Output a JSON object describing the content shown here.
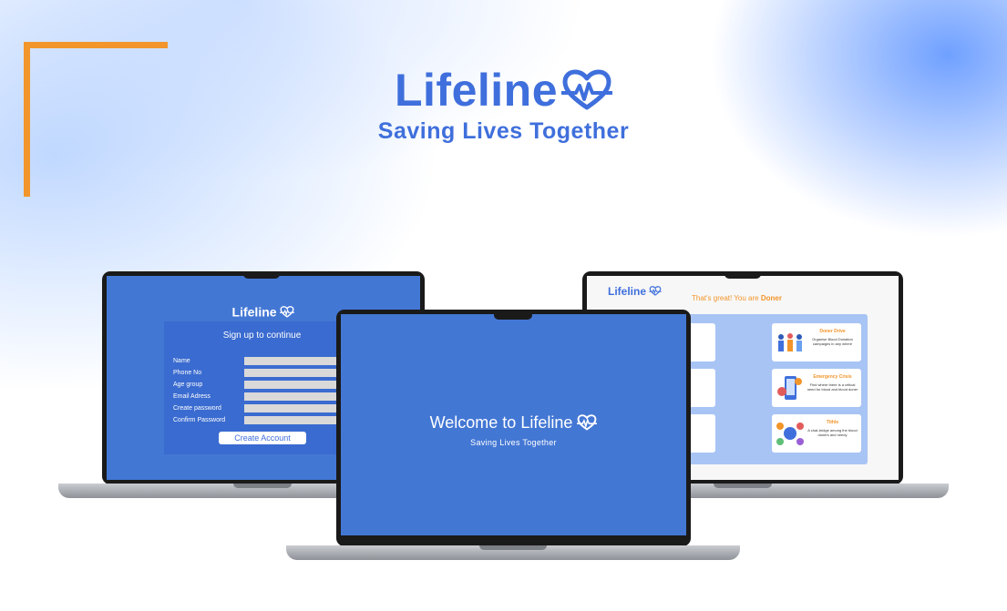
{
  "hero": {
    "brand": "Lifeline",
    "tagline": "Saving Lives Together"
  },
  "signup": {
    "brand": "Lifeline",
    "title": "Sign up to continue",
    "fields": [
      "Name",
      "Phone No",
      "Age group",
      "Email Adress",
      "Create password",
      "Confirm Password"
    ],
    "button": "Create Account"
  },
  "welcome": {
    "title": "Welcome to Lifeline",
    "subtitle": "Saving Lives Together"
  },
  "dashboard": {
    "brand": "Lifeline",
    "heading_prefix": "That's great! You are",
    "role": "Doner",
    "cards": [
      {
        "title": "Doner Drive",
        "desc": "Organise Blood Donation campaigns in any where"
      },
      {
        "title": "Emergency Crisis",
        "desc": "Find where there is a critical need for blood and blood doner"
      },
      {
        "title": "Tithle",
        "desc": "A chat-bridge among the blood doners and needy"
      }
    ]
  },
  "colors": {
    "brand_blue": "#3f6fdc",
    "screen_blue": "#4377d4",
    "accent_orange": "#f2952b"
  },
  "icons": [
    "heartbeat-heart-icon"
  ]
}
